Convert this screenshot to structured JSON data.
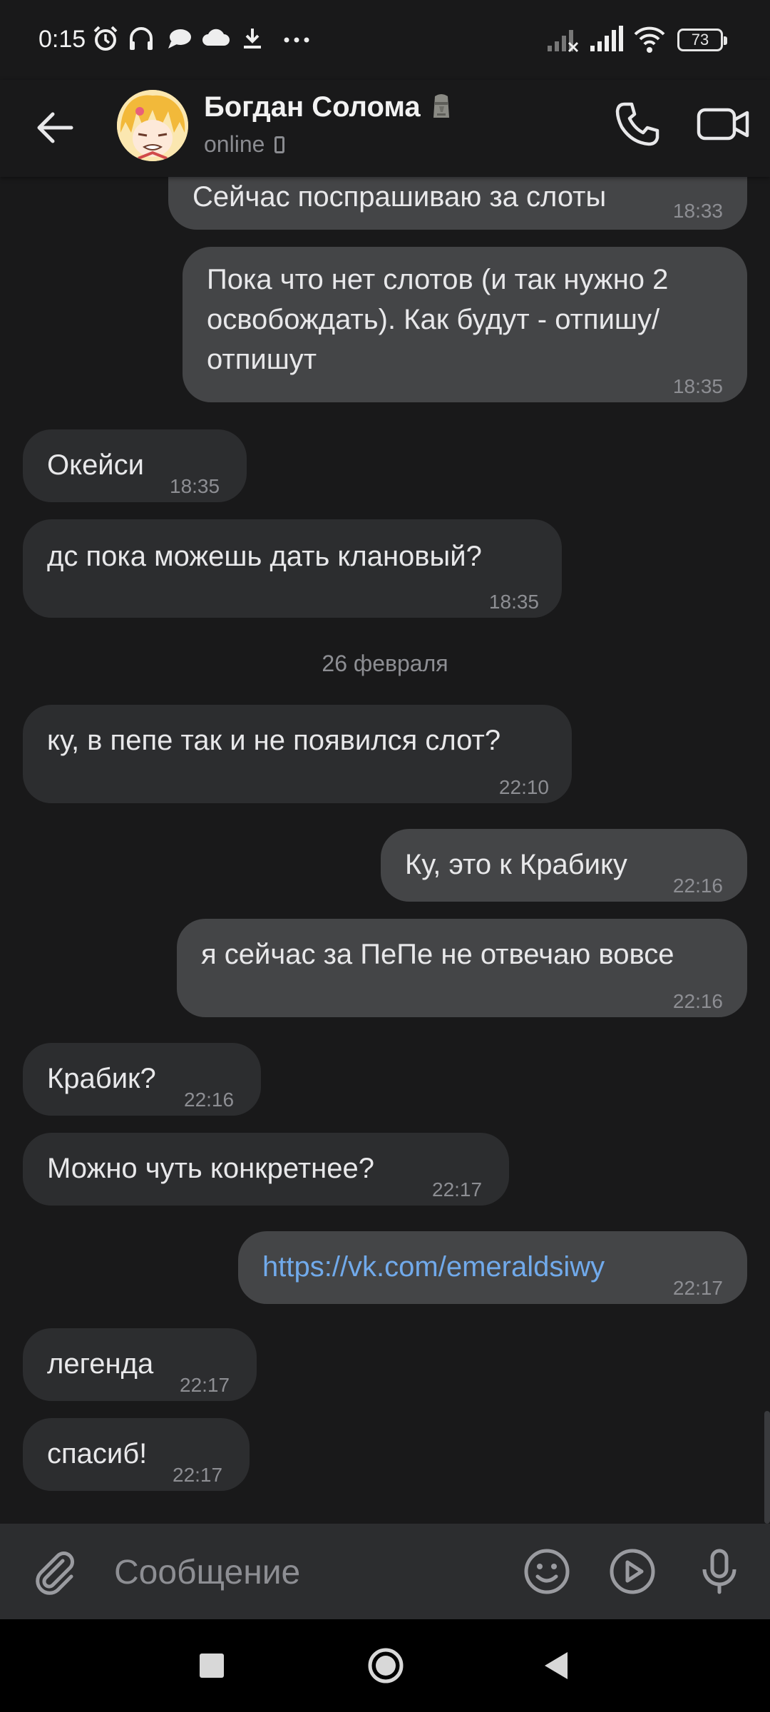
{
  "status_bar": {
    "time": "0:15",
    "battery": "73"
  },
  "header": {
    "contact_name": "Богдан Солома",
    "contact_status": "online"
  },
  "messages": [
    {
      "direction": "in",
      "text": "Сейчас поспрашиваю за слоты",
      "time": "18:33"
    },
    {
      "direction": "out",
      "lines": [
        "Пока что нет слотов (и так нужно 2",
        "освобождать). Как будут - отпишу/",
        "отпишут"
      ],
      "time": "18:35"
    },
    {
      "direction": "in",
      "text": "Окейси",
      "time": "18:35"
    },
    {
      "direction": "in",
      "text": "дс пока можешь дать клановый?",
      "time": "18:35"
    },
    {
      "direction": "in",
      "text": "ку, в пепе так и не появился слот?",
      "time": "22:10"
    },
    {
      "direction": "out",
      "text": "Ку, это к Крабику",
      "time": "22:16"
    },
    {
      "direction": "out",
      "text": "я сейчас за ПеПе не отвечаю вовсе",
      "time": "22:16"
    },
    {
      "direction": "in",
      "text": "Крабик?",
      "time": "22:16"
    },
    {
      "direction": "in",
      "text": "Можно чуть конкретнее?",
      "time": "22:17"
    },
    {
      "direction": "out",
      "text": "https://vk.com/emeraldsiwy",
      "time": "22:17"
    },
    {
      "direction": "in",
      "text": "легенда",
      "time": "22:17"
    },
    {
      "direction": "in",
      "text": "спасиб!",
      "time": "22:17"
    }
  ],
  "date_separator": "26 февраля",
  "composer": {
    "placeholder": "Сообщение"
  },
  "colors": {
    "background": "#19191a",
    "incoming_bubble": "#2c2d2f",
    "outgoing_bubble": "#444547",
    "link": "#71aaeb",
    "secondary_text": "#8d8e93"
  },
  "icons": [
    "alarm-icon",
    "headphones-icon",
    "chat-bubble-icon",
    "cloud-icon",
    "download-icon",
    "more-icon",
    "no-signal-icon",
    "signal-icon",
    "wifi-icon",
    "back-arrow-icon",
    "moai-emoji-icon",
    "phone-call-icon",
    "video-call-icon",
    "attach-icon",
    "emoji-icon",
    "video-message-icon",
    "microphone-icon",
    "recents-icon",
    "home-icon",
    "back-icon"
  ]
}
